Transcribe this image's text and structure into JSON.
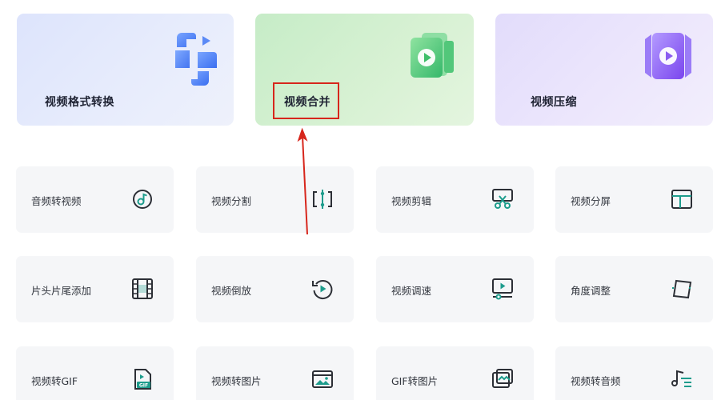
{
  "features": {
    "convert": {
      "label": "视频格式转换",
      "icon": "format-convert-icon",
      "color": "#4e7df2"
    },
    "merge": {
      "label": "视频合并",
      "icon": "video-merge-icon",
      "color": "#3fbf6a"
    },
    "compress": {
      "label": "视频压缩",
      "icon": "video-compress-icon",
      "color": "#8b5cf0"
    }
  },
  "tools": [
    [
      {
        "label": "音频转视频",
        "icon": "audio-to-video-icon"
      },
      {
        "label": "视频分割",
        "icon": "split-icon"
      },
      {
        "label": "视频剪辑",
        "icon": "scissors-icon"
      },
      {
        "label": "视频分屏",
        "icon": "split-screen-icon"
      }
    ],
    [
      {
        "label": "片头片尾添加",
        "icon": "film-strip-icon"
      },
      {
        "label": "视频倒放",
        "icon": "reverse-play-icon"
      },
      {
        "label": "视频调速",
        "icon": "speed-icon"
      },
      {
        "label": "角度调整",
        "icon": "rotate-icon"
      }
    ],
    [
      {
        "label": "视频转GIF",
        "icon": "gif-file-icon"
      },
      {
        "label": "视频转图片",
        "icon": "image-icon"
      },
      {
        "label": "GIF转图片",
        "icon": "gif-to-image-icon"
      },
      {
        "label": "视频转音频",
        "icon": "music-note-icon"
      }
    ]
  ],
  "annotation": {
    "highlight_color": "#d7261c"
  },
  "icon_color": "#1d9c8c",
  "icon_dark": "#2c2f36"
}
